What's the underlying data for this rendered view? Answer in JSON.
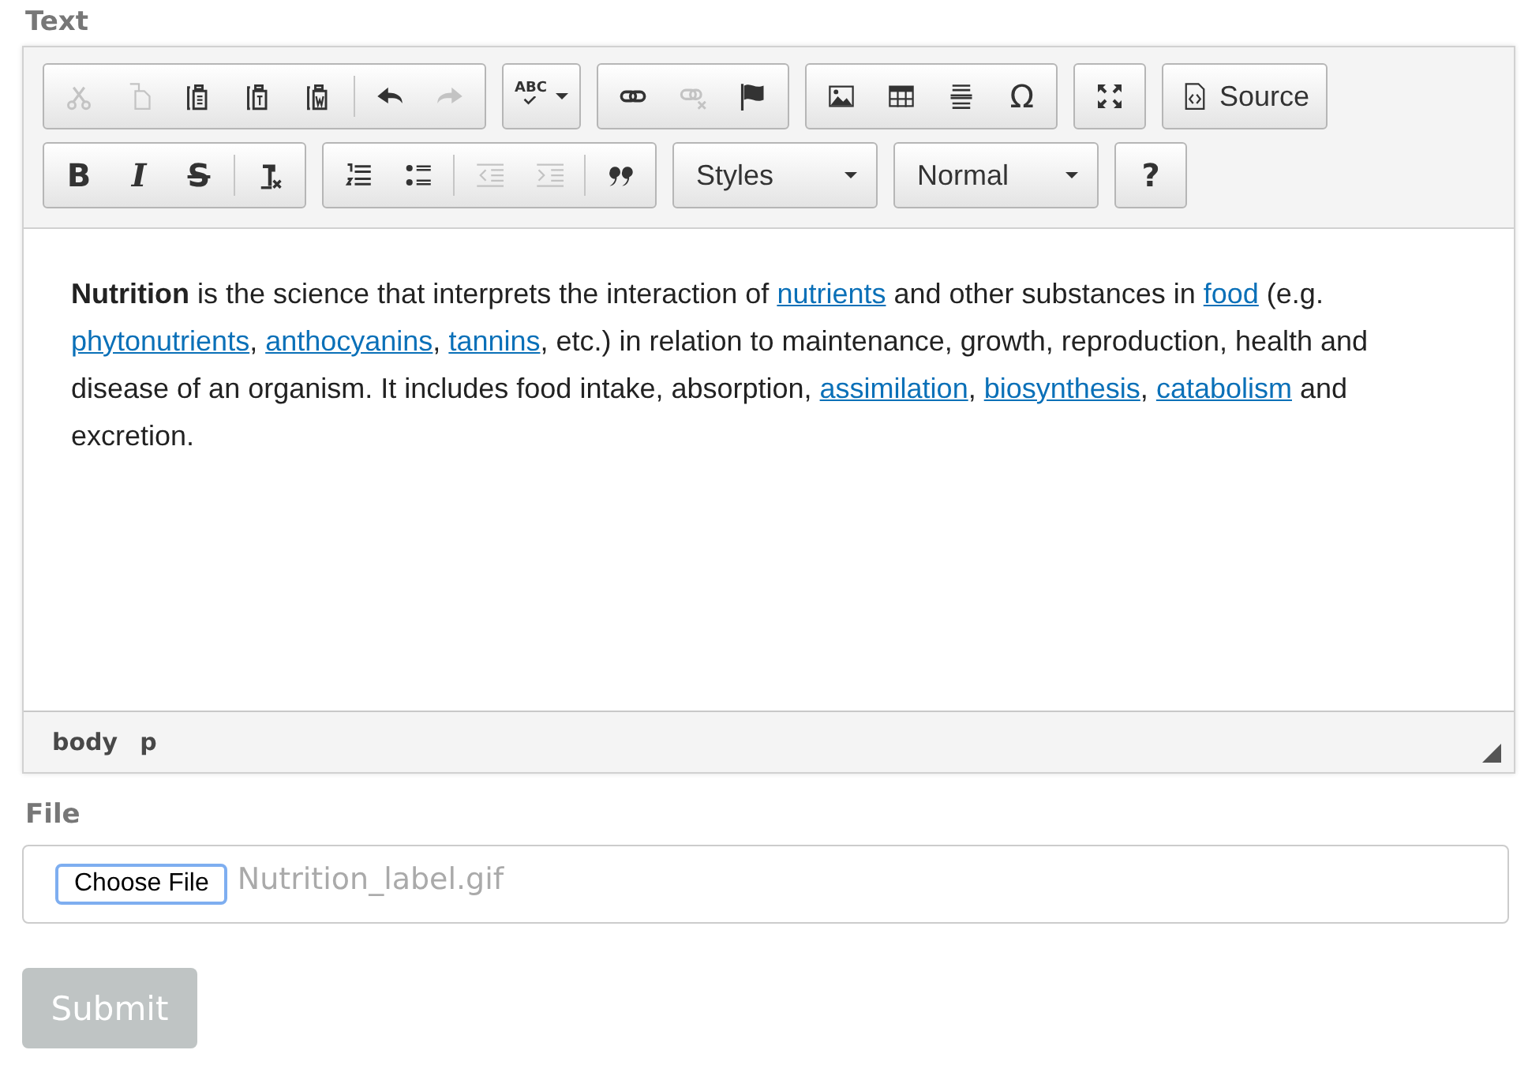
{
  "text_label": "Text",
  "toolbar": [
    [
      {
        "parts": [
          [
            {
              "kind": "icon",
              "disabled": true
            },
            {
              "kind": "icon",
              "disabled": true
            },
            {
              "kind": "icon",
              "disabled": false
            },
            {
              "kind": "icon",
              "disabled": false
            },
            {
              "kind": "icon",
              "disabled": false
            }
          ],
          [
            {
              "kind": "icon",
              "disabled": false
            },
            {
              "kind": "icon",
              "disabled": true
            }
          ]
        ]
      },
      {
        "parts": [
          [
            {
              "kind": "spell",
              "label": "ABC",
              "disabled": false
            }
          ]
        ]
      },
      {
        "parts": [
          [
            {
              "kind": "icon",
              "disabled": false
            },
            {
              "kind": "icon",
              "disabled": true
            },
            {
              "kind": "icon",
              "disabled": false
            }
          ]
        ]
      },
      {
        "parts": [
          [
            {
              "kind": "icon",
              "disabled": false
            },
            {
              "kind": "icon",
              "disabled": false
            },
            {
              "kind": "icon",
              "disabled": false
            },
            {
              "kind": "glyph",
              "label": "Ω",
              "disabled": false
            }
          ]
        ]
      },
      {
        "parts": [
          [
            {
              "kind": "icon",
              "disabled": false
            }
          ]
        ]
      },
      {
        "parts": [
          [
            {
              "kind": "text",
              "label": "Source",
              "disabled": false
            }
          ]
        ]
      }
    ],
    [
      {
        "parts": [
          [
            {
              "kind": "glyph",
              "label": "B",
              "disabled": false
            },
            {
              "kind": "glyph",
              "label": "I",
              "disabled": false
            },
            {
              "kind": "glyph",
              "label": "S",
              "disabled": false
            }
          ],
          [
            {
              "kind": "icon",
              "disabled": false
            }
          ]
        ]
      },
      {
        "parts": [
          [
            {
              "kind": "icon",
              "disabled": false
            },
            {
              "kind": "icon",
              "disabled": false
            }
          ],
          [
            {
              "kind": "icon",
              "disabled": true
            },
            {
              "kind": "icon",
              "disabled": true
            }
          ],
          [
            {
              "kind": "icon",
              "disabled": false
            }
          ]
        ]
      },
      {
        "parts": [
          [
            {
              "kind": "combo",
              "label": "Styles",
              "disabled": false
            }
          ]
        ]
      },
      {
        "parts": [
          [
            {
              "kind": "combo",
              "label": "Normal",
              "disabled": false
            }
          ]
        ]
      },
      {
        "parts": [
          [
            {
              "kind": "glyph",
              "label": "?",
              "disabled": false
            }
          ]
        ]
      }
    ]
  ],
  "content": [
    {
      "kind": "bold",
      "text": "Nutrition"
    },
    {
      "kind": "plain",
      "text": " is the science that interprets the interaction of "
    },
    {
      "kind": "link",
      "text": "nutrients"
    },
    {
      "kind": "plain",
      "text": " and other substances in "
    },
    {
      "kind": "link",
      "text": "food"
    },
    {
      "kind": "plain",
      "text": " (e.g. "
    },
    {
      "kind": "link",
      "text": "phytonutrients"
    },
    {
      "kind": "plain",
      "text": ", "
    },
    {
      "kind": "link",
      "text": "anthocyanins"
    },
    {
      "kind": "plain",
      "text": ", "
    },
    {
      "kind": "link",
      "text": "tannins"
    },
    {
      "kind": "plain",
      "text": ", etc.) in relation to maintenance, growth, reproduction, health and disease of an organism. It includes food intake, absorption, "
    },
    {
      "kind": "link",
      "text": "assimilation"
    },
    {
      "kind": "plain",
      "text": ", "
    },
    {
      "kind": "link",
      "text": "biosynthesis"
    },
    {
      "kind": "plain",
      "text": ", "
    },
    {
      "kind": "link",
      "text": "catabolism"
    },
    {
      "kind": "plain",
      "text": " and excretion."
    }
  ],
  "path": [
    "body",
    "p"
  ],
  "file_label": "File",
  "file": {
    "button": "Choose File",
    "value": "Nutrition_label.gif"
  },
  "submit": {
    "label": "Submit",
    "disabled": true
  }
}
